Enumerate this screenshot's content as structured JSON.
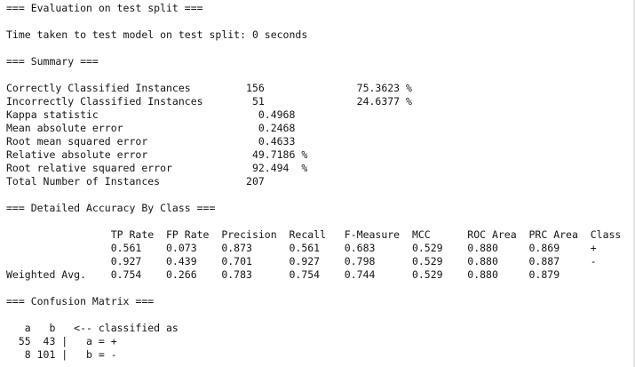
{
  "output": {
    "lines": [
      "=== Evaluation on test split ===",
      "",
      "Time taken to test model on test split: 0 seconds",
      "",
      "=== Summary ===",
      "",
      "Correctly Classified Instances         156               75.3623 %",
      "Incorrectly Classified Instances        51               24.6377 %",
      "Kappa statistic                          0.4968",
      "Mean absolute error                      0.2468",
      "Root mean squared error                  0.4633",
      "Relative absolute error                 49.7186 %",
      "Root relative squared error             92.494  %",
      "Total Number of Instances              207     ",
      "",
      "=== Detailed Accuracy By Class ===",
      "",
      "                 TP Rate  FP Rate  Precision  Recall   F-Measure  MCC      ROC Area  PRC Area  Class",
      "                 0.561    0.073    0.873      0.561    0.683      0.529    0.880     0.869     +",
      "                 0.927    0.439    0.701      0.927    0.798      0.529    0.880     0.887     -",
      "Weighted Avg.    0.754    0.266    0.783      0.754    0.744      0.529    0.880     0.879     ",
      "",
      "=== Confusion Matrix ===",
      "",
      "   a   b   <-- classified as",
      "  55  43 |   a = +",
      "   8 101 |   b = -"
    ]
  }
}
